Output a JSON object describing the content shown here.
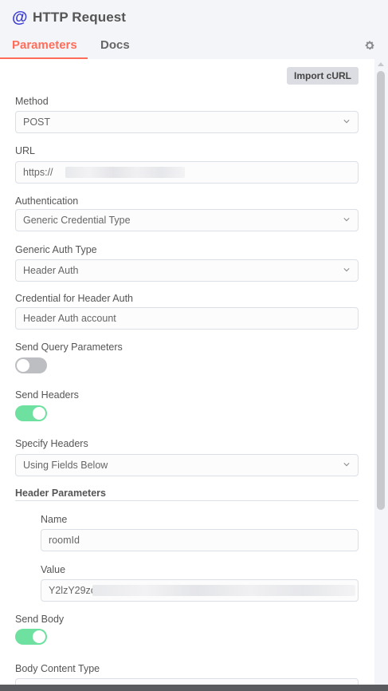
{
  "header": {
    "icon": "at-icon",
    "title": "HTTP Request",
    "tabs": [
      {
        "label": "Parameters",
        "active": true
      },
      {
        "label": "Docs",
        "active": false
      }
    ],
    "settings_icon": "gear-icon",
    "accent_color": "#ff6d5a"
  },
  "toolbar": {
    "import_label": "Import cURL"
  },
  "form": {
    "method": {
      "label": "Method",
      "value": "POST"
    },
    "url": {
      "label": "URL",
      "value": "https://"
    },
    "authentication": {
      "label": "Authentication",
      "value": "Generic Credential Type"
    },
    "generic_auth_type": {
      "label": "Generic Auth Type",
      "value": "Header Auth"
    },
    "credential": {
      "label": "Credential for Header Auth",
      "value": "Header Auth account"
    },
    "send_query": {
      "label": "Send Query Parameters",
      "enabled": false
    },
    "send_headers": {
      "label": "Send Headers",
      "enabled": true
    },
    "specify_headers": {
      "label": "Specify Headers",
      "value": "Using Fields Below"
    },
    "header_parameters": {
      "title": "Header Parameters",
      "name_label": "Name",
      "name_value": "roomId",
      "value_label": "Value",
      "value_value": "Y2lzY29zc"
    },
    "send_body": {
      "label": "Send Body",
      "enabled": true
    },
    "body_content_type": {
      "label": "Body Content Type"
    }
  }
}
